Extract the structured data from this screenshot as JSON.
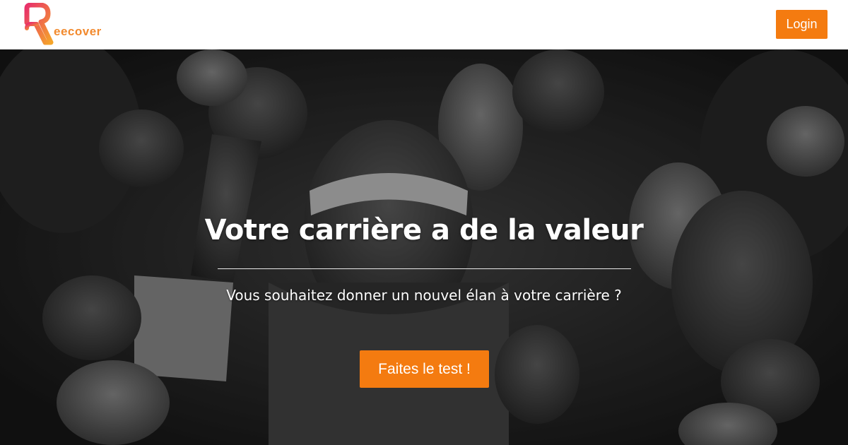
{
  "header": {
    "logo_text": "eecover",
    "login_label": "Login"
  },
  "hero": {
    "title": "Votre carrière a de la valeur",
    "subtitle": "Vous souhaitez donner un nouvel élan à votre carrière ?",
    "cta_label": "Faites le test !"
  },
  "colors": {
    "accent": "#f47b10",
    "logo_gradient_start": "#e8306a",
    "logo_gradient_end": "#f5a52a",
    "header_bg": "#ffffff",
    "hero_text": "#ffffff"
  },
  "icons": {
    "logo_mark": "r-logo-icon"
  }
}
